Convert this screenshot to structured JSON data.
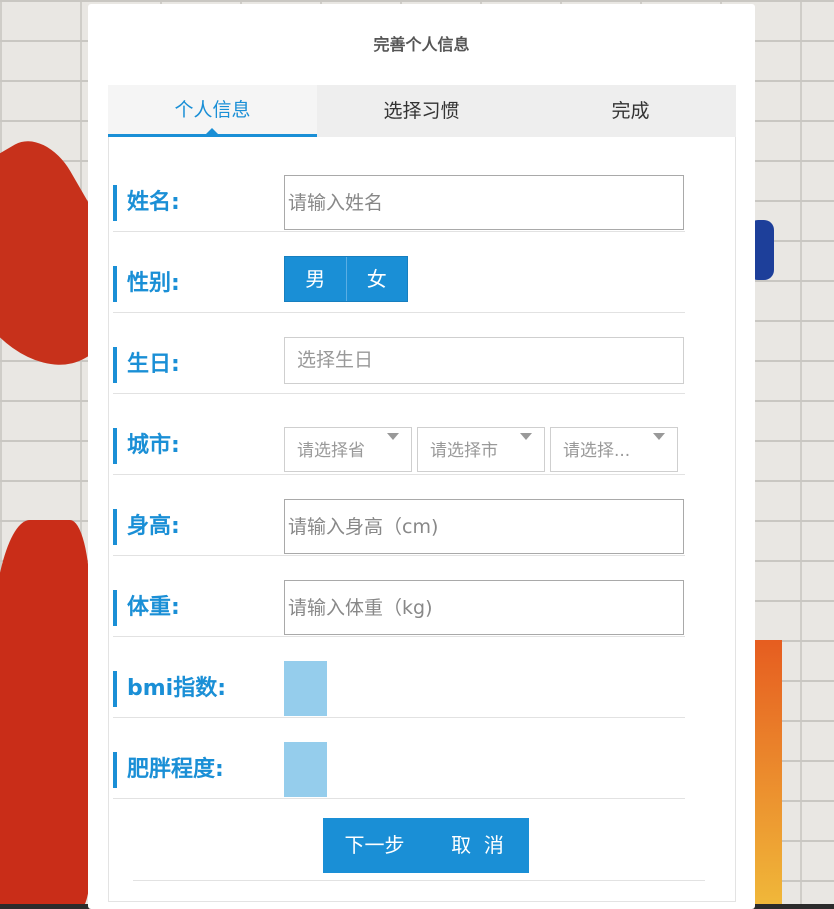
{
  "modal": {
    "title": "完善个人信息"
  },
  "tabs": [
    {
      "label": "个人信息",
      "active": true
    },
    {
      "label": "选择习惯",
      "active": false
    },
    {
      "label": "完成",
      "active": false
    }
  ],
  "form": {
    "name": {
      "label": "姓名:",
      "placeholder": "请输入姓名"
    },
    "gender": {
      "label": "性别:",
      "options": [
        "男",
        "女"
      ]
    },
    "birthday": {
      "label": "生日:",
      "placeholder": "选择生日"
    },
    "city": {
      "label": "城市:",
      "province_placeholder": "请选择省",
      "city_placeholder": "请选择市",
      "district_placeholder": "请选择..."
    },
    "height": {
      "label": "身高:",
      "placeholder": "请输入身高（cm)"
    },
    "weight": {
      "label": "体重:",
      "placeholder": "请输入体重（kg)"
    },
    "bmi": {
      "label": "bmi指数:"
    },
    "obesity": {
      "label": "肥胖程度:"
    }
  },
  "buttons": {
    "next": "下一步",
    "cancel": "取  消"
  },
  "colors": {
    "accent": "#1a8fd6",
    "metric_box": "#95cdec"
  }
}
